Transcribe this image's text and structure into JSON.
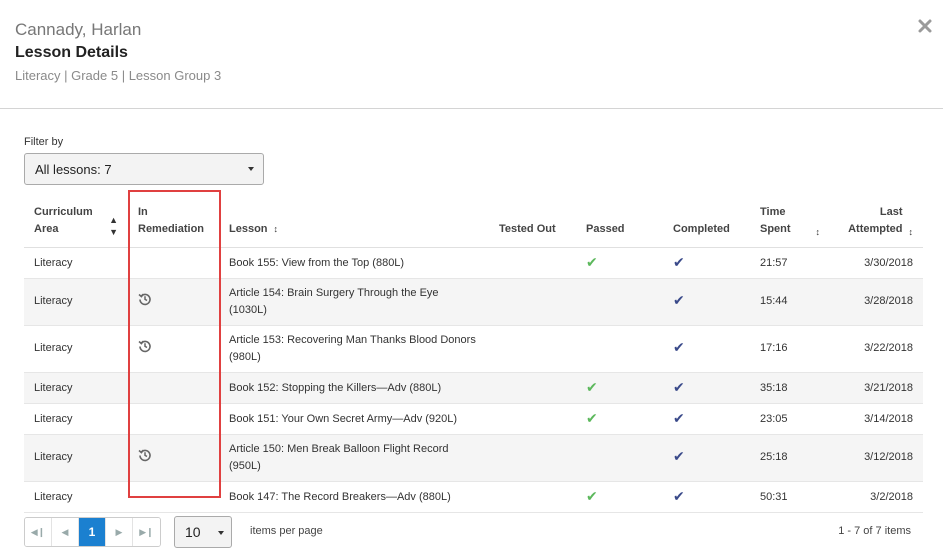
{
  "header": {
    "student_name": "Cannady, Harlan",
    "title": "Lesson Details",
    "subtitle": "Literacy | Grade 5 | Lesson Group 3"
  },
  "filter": {
    "label": "Filter by",
    "selected": "All lessons: 7"
  },
  "table": {
    "columns": {
      "curriculum_area": [
        "Curriculum",
        "Area"
      ],
      "in_remediation": [
        "In",
        "Remediation"
      ],
      "lesson": "Lesson",
      "tested_out": "Tested Out",
      "passed": "Passed",
      "completed": "Completed",
      "time_spent": [
        "Time",
        "Spent"
      ],
      "last_attempted": [
        "Last",
        "Attempted"
      ]
    },
    "rows": [
      {
        "area": "Literacy",
        "remediation": false,
        "lesson": "Book 155: View from the Top (880L)",
        "tested_out": "",
        "passed": true,
        "completed": true,
        "time": "21:57",
        "last": "3/30/2018"
      },
      {
        "area": "Literacy",
        "remediation": true,
        "lesson": "Article 154: Brain Surgery Through the Eye (1030L)",
        "tested_out": "",
        "passed": false,
        "completed": true,
        "time": "15:44",
        "last": "3/28/2018"
      },
      {
        "area": "Literacy",
        "remediation": true,
        "lesson": "Article 153: Recovering Man Thanks Blood Donors (980L)",
        "tested_out": "",
        "passed": false,
        "completed": true,
        "time": "17:16",
        "last": "3/22/2018"
      },
      {
        "area": "Literacy",
        "remediation": false,
        "lesson": "Book 152: Stopping the Killers—Adv (880L)",
        "tested_out": "",
        "passed": true,
        "completed": true,
        "time": "35:18",
        "last": "3/21/2018"
      },
      {
        "area": "Literacy",
        "remediation": false,
        "lesson": "Book 151: Your Own Secret Army—Adv (920L)",
        "tested_out": "",
        "passed": true,
        "completed": true,
        "time": "23:05",
        "last": "3/14/2018"
      },
      {
        "area": "Literacy",
        "remediation": true,
        "lesson": "Article 150: Men Break Balloon Flight Record (950L)",
        "tested_out": "",
        "passed": false,
        "completed": true,
        "time": "25:18",
        "last": "3/12/2018"
      },
      {
        "area": "Literacy",
        "remediation": false,
        "lesson": "Book 147: The Record Breakers—Adv (880L)",
        "tested_out": "",
        "passed": true,
        "completed": true,
        "time": "50:31",
        "last": "3/2/2018"
      }
    ]
  },
  "pagination": {
    "current_page": "1",
    "page_size": "10",
    "per_page_label": "items per page",
    "info": "1 - 7 of 7 items"
  },
  "icons": {
    "close": "close-icon",
    "sort": "sort-icon",
    "remediation": "history-icon",
    "passed": "checkmark-icon",
    "completed": "checkmark-icon"
  },
  "colors": {
    "passed_check": "#5cb85c",
    "completed_check": "#3a4a8a",
    "active_page": "#1b80d0",
    "highlight": "#e04040"
  }
}
